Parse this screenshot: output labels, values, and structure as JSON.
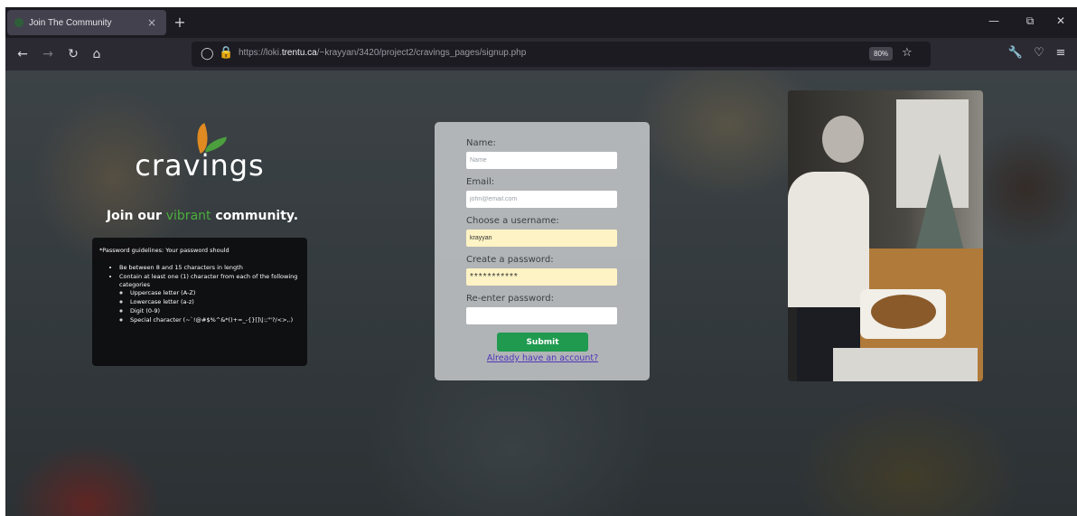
{
  "browser": {
    "tab_title": "Join The Community",
    "tab_close": "×",
    "new_tab": "+",
    "url_prefix": "https://loki.",
    "url_host": "trentu.ca",
    "url_path": "/~krayyan/3420/project2/cravings_pages/signup.php",
    "zoom": "80%"
  },
  "page": {
    "logo_text": "cravings",
    "join_prefix": "Join our ",
    "join_accent": "vibrant",
    "join_suffix": " community.",
    "guidelines": {
      "intro": "*Password guidelines: Your password should",
      "rules": [
        "Be between 8 and 15 characters in length",
        "Contain at least one (1) character from each of the following categories"
      ],
      "categories": [
        "Uppercase letter (A-Z)",
        "Lowercase letter (a-z)",
        "Digit (0-9)",
        "Special character (~`!@#$%^&*()+=_-{}[]\\|:;\"'?/<>,.)"
      ]
    },
    "form": {
      "name_label": "Name:",
      "name_placeholder": "Name",
      "email_label": "Email:",
      "email_placeholder": "john@email.com",
      "username_label": "Choose a username:",
      "username_value": "krayyan",
      "password_label": "Create a password:",
      "password_value": "***********",
      "reenter_label": "Re-enter password:",
      "reenter_value": "",
      "submit_label": "Submit",
      "account_link": "Already have an account?"
    }
  },
  "colors": {
    "accent_green": "#1f9a4f",
    "vibrant_green": "#4bae3c",
    "link_purple": "#4f35b8",
    "autofill_yellow": "#fdf3c4"
  }
}
